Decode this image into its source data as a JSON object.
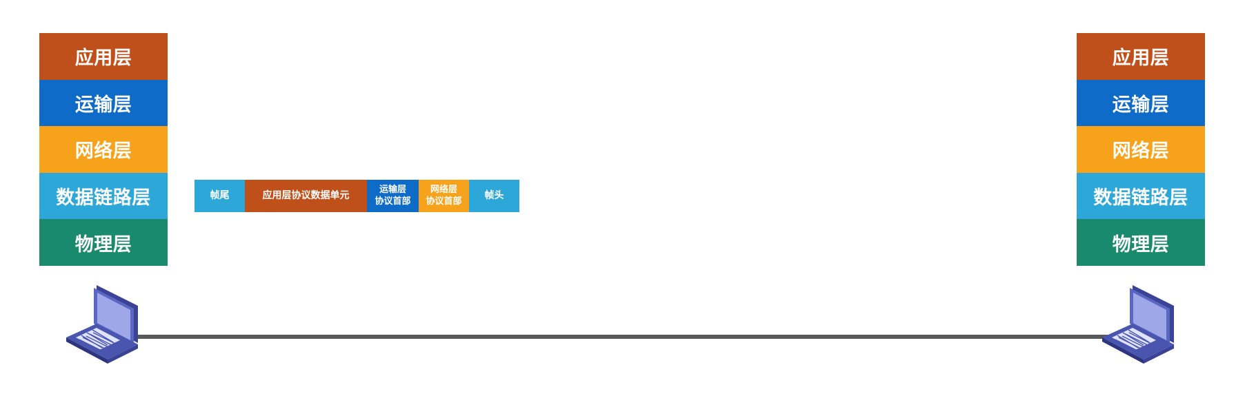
{
  "stack_left": {
    "layers": [
      {
        "label": "应用层",
        "color": "#c0501a"
      },
      {
        "label": "运输层",
        "color": "#0e6bc7"
      },
      {
        "label": "网络层",
        "color": "#f7a21b"
      },
      {
        "label": "数据链路层",
        "color": "#2da7d8"
      },
      {
        "label": "物理层",
        "color": "#198a6e"
      }
    ]
  },
  "stack_right": {
    "layers": [
      {
        "label": "应用层",
        "color": "#c0501a"
      },
      {
        "label": "运输层",
        "color": "#0e6bc7"
      },
      {
        "label": "网络层",
        "color": "#f7a21b"
      },
      {
        "label": "数据链路层",
        "color": "#2da7d8"
      },
      {
        "label": "物理层",
        "color": "#198a6e"
      }
    ]
  },
  "frame": {
    "trailer": "帧尾",
    "app_pdu": "应用层协议数据单元",
    "transport_header": {
      "line1": "运输层",
      "line2": "协议首部"
    },
    "network_header": {
      "line1": "网络层",
      "line2": "协议首部"
    },
    "header": "帧头"
  },
  "icons": {
    "left_host": "laptop-icon",
    "right_host": "laptop-icon"
  },
  "colors": {
    "link": "#58595b",
    "laptop_screen": "#9ea8e8",
    "laptop_body": "#4a55b0"
  }
}
